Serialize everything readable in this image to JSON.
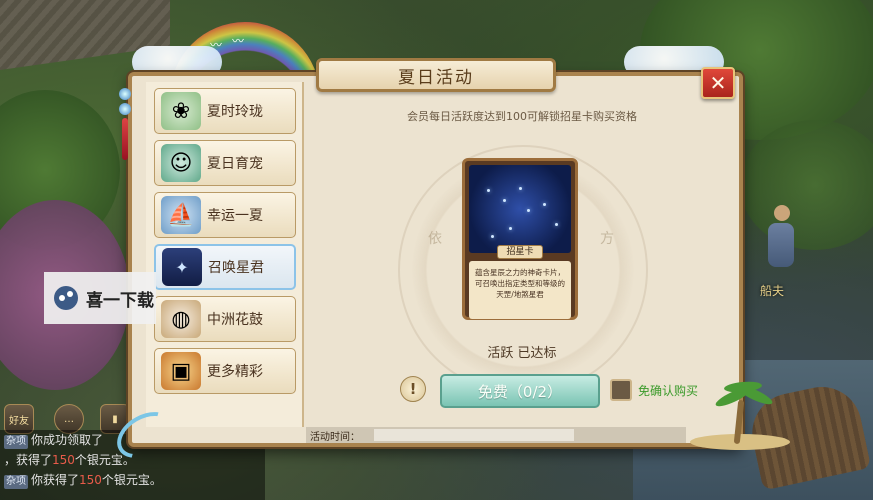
{
  "panel": {
    "title": "夏日活动",
    "close_label": "✕",
    "info_text": "会员每日活跃度达到100可解锁招星卡购买资格",
    "card": {
      "name": "招星卡",
      "description": "蕴含星辰之力的神奇卡片，可召唤出指定类型和等级的天罡/地煞星君"
    },
    "mandala_left": "依",
    "mandala_right": "方",
    "status_text": "活跃 已达标",
    "help_label": "!",
    "free_button": "免费（0/2）",
    "auto_confirm_label": "免确认购买",
    "time_label": "活动时间："
  },
  "sidebar": {
    "items": [
      {
        "label": "夏时玲珑",
        "icon": "jade-ornament-icon",
        "active": false
      },
      {
        "label": "夏日育宠",
        "icon": "pet-icon",
        "active": false
      },
      {
        "label": "幸运一夏",
        "icon": "boat-icon",
        "active": false
      },
      {
        "label": "召唤星君",
        "icon": "star-card-icon",
        "active": true
      },
      {
        "label": "中洲花鼓",
        "icon": "drum-icon",
        "active": false
      },
      {
        "label": "更多精彩",
        "icon": "treasure-chest-icon",
        "active": false
      }
    ]
  },
  "overlay": {
    "download_text": "喜一下载"
  },
  "hud": {
    "friend_label": "好友",
    "npc_name": "船夫"
  },
  "chat": {
    "lines": [
      {
        "tag": "杂项",
        "pre": "你成功领取了",
        "num": "",
        "post": ""
      },
      {
        "tag": "",
        "pre": "，获得了",
        "num": "150",
        "post": "个银元宝。"
      },
      {
        "tag": "杂项",
        "pre": "你获得了",
        "num": "150",
        "post": "个银元宝。"
      }
    ]
  },
  "colors": {
    "accent_frame": "#a9834e",
    "active_tab_border": "#8cc3e8",
    "free_button": "#7ac4b3",
    "close_button": "#c0342a",
    "confirm_text": "#3a9a2a"
  }
}
